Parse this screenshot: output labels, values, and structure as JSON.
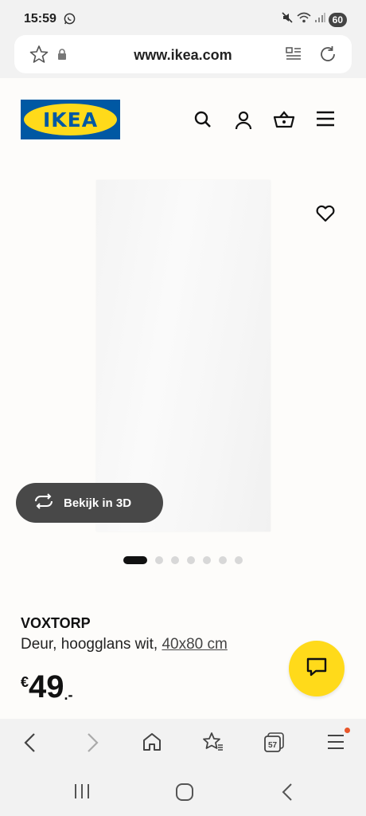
{
  "status_bar": {
    "time": "15:59",
    "battery": "60"
  },
  "url_bar": {
    "url": "www.ikea.com"
  },
  "header": {
    "logo_text": "IKEA"
  },
  "product": {
    "view_3d_label": "Bekijk in 3D",
    "name": "VOXTORP",
    "desc_prefix": "Deur, hoogglans wit, ",
    "size": "40x80 cm",
    "price_currency": "€",
    "price_int": "49",
    "price_dec": ".-"
  },
  "carousel": {
    "total": 7,
    "active": 1
  },
  "browser_nav": {
    "tabs_count": "57"
  },
  "colors": {
    "ikea_blue": "#0058a3",
    "ikea_yellow": "#ffda1a",
    "badge": "#e8562a"
  }
}
